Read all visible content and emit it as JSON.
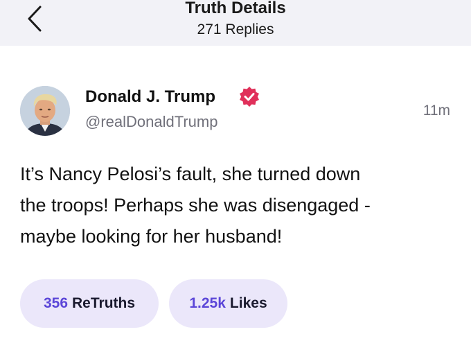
{
  "header": {
    "title": "Truth Details",
    "subtitle": "271 Replies",
    "back_icon": "chevron-left-icon"
  },
  "post": {
    "author_name": "Donald J. Trump",
    "handle": "@realDonaldTrump",
    "verified_icon": "verified-badge-icon",
    "timestamp": "11m",
    "text_lines": [
      "It’s Nancy Pelosi’s fault, she turned down",
      "the troops! Perhaps she was disengaged -",
      "maybe looking for her husband!"
    ]
  },
  "stats": {
    "retruths_count": "356",
    "retruths_label": "ReTruths",
    "likes_count": "1.25k",
    "likes_label": "Likes"
  },
  "colors": {
    "header_bg": "#f2f2f7",
    "accent": "#5b46d8",
    "pill_bg": "#ebe7fa",
    "verified": "#e0305a"
  }
}
